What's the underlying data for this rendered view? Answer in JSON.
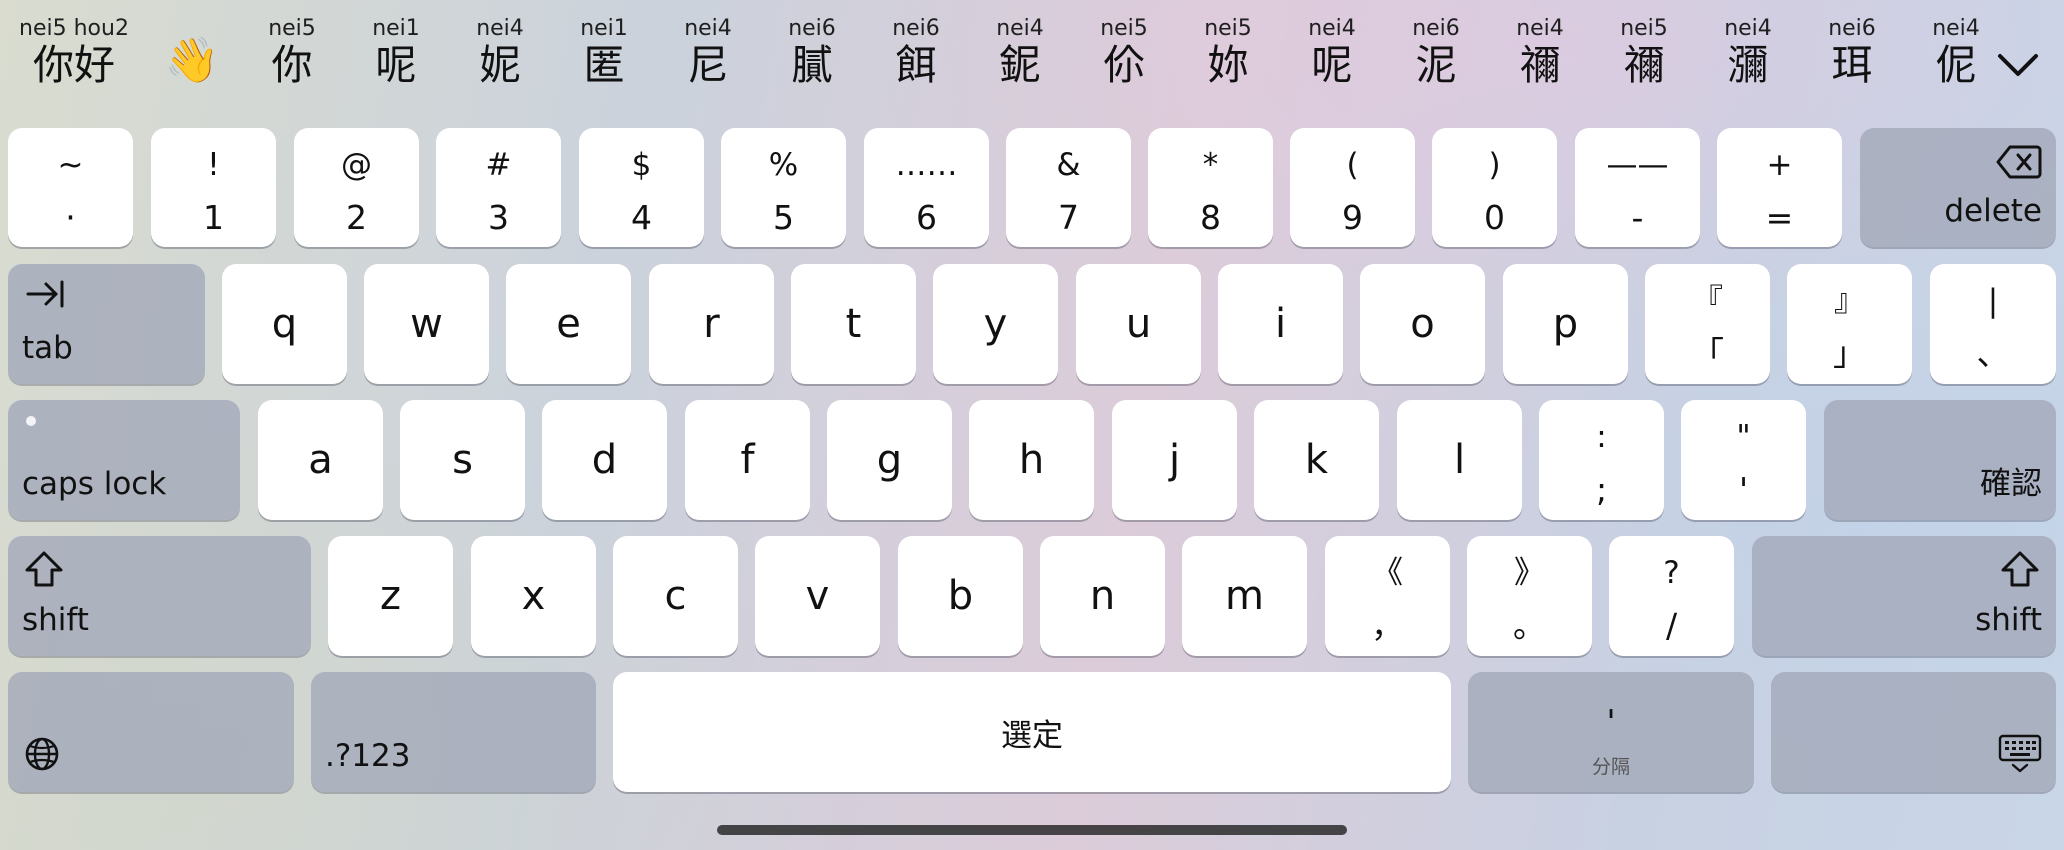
{
  "candidates": [
    {
      "romanization": "nei5 hou2",
      "text": "你好"
    },
    {
      "romanization": "",
      "text": "👋"
    },
    {
      "romanization": "nei5",
      "text": "你"
    },
    {
      "romanization": "nei1",
      "text": "呢"
    },
    {
      "romanization": "nei4",
      "text": "妮"
    },
    {
      "romanization": "nei1",
      "text": "匿"
    },
    {
      "romanization": "nei4",
      "text": "尼"
    },
    {
      "romanization": "nei6",
      "text": "膩"
    },
    {
      "romanization": "nei6",
      "text": "餌"
    },
    {
      "romanization": "nei4",
      "text": "鈮"
    },
    {
      "romanization": "nei5",
      "text": "伱"
    },
    {
      "romanization": "nei5",
      "text": "妳"
    },
    {
      "romanization": "nei4",
      "text": "呢"
    },
    {
      "romanization": "nei6",
      "text": "泥"
    },
    {
      "romanization": "nei4",
      "text": "禰"
    },
    {
      "romanization": "nei5",
      "text": "禰"
    },
    {
      "romanization": "nei4",
      "text": "瀰"
    },
    {
      "romanization": "nei6",
      "text": "珥"
    },
    {
      "romanization": "nei4",
      "text": "伲"
    }
  ],
  "expand_icon": "chevron-down-icon",
  "row1": [
    {
      "name": "tilde",
      "upper": "~",
      "lower": "·"
    },
    {
      "name": "1",
      "upper": "!",
      "lower": "1"
    },
    {
      "name": "2",
      "upper": "@",
      "lower": "2"
    },
    {
      "name": "3",
      "upper": "#",
      "lower": "3"
    },
    {
      "name": "4",
      "upper": "$",
      "lower": "4"
    },
    {
      "name": "5",
      "upper": "%",
      "lower": "5"
    },
    {
      "name": "6",
      "upper": "……",
      "lower": "6"
    },
    {
      "name": "7",
      "upper": "&",
      "lower": "7"
    },
    {
      "name": "8",
      "upper": "*",
      "lower": "8"
    },
    {
      "name": "9",
      "upper": "(",
      "lower": "9"
    },
    {
      "name": "0",
      "upper": ")",
      "lower": "0"
    },
    {
      "name": "dash",
      "upper": "——",
      "lower": "-"
    },
    {
      "name": "equals",
      "upper": "+",
      "lower": "="
    }
  ],
  "delete_label": "delete",
  "tab_label": "tab",
  "row2_letters": [
    "q",
    "w",
    "e",
    "r",
    "t",
    "y",
    "u",
    "i",
    "o",
    "p"
  ],
  "row2_punct": [
    {
      "name": "left-corner-bracket",
      "upper": "『",
      "lower": "「"
    },
    {
      "name": "right-corner-bracket",
      "upper": "』",
      "lower": "」"
    },
    {
      "name": "pipe",
      "upper": "|",
      "lower": "、"
    }
  ],
  "caps_lock_label": "caps lock",
  "row3_letters": [
    "a",
    "s",
    "d",
    "f",
    "g",
    "h",
    "j",
    "k",
    "l"
  ],
  "row3_punct": [
    {
      "name": "semicolon",
      "upper": ":",
      "lower": ";"
    },
    {
      "name": "quote",
      "upper": "\"",
      "lower": "'"
    }
  ],
  "confirm_label": "確認",
  "shift_label": "shift",
  "row4_letters": [
    "z",
    "x",
    "c",
    "v",
    "b",
    "n",
    "m"
  ],
  "row4_punct": [
    {
      "name": "comma",
      "upper": "《",
      "lower": "，"
    },
    {
      "name": "period",
      "upper": "》",
      "lower": "。"
    },
    {
      "name": "slash",
      "upper": "?",
      "lower": "/"
    }
  ],
  "numbers_label": ".?123",
  "space_label": "選定",
  "separator": {
    "symbol": "'",
    "label": "分隔"
  },
  "colors": {
    "key": "#ffffff",
    "function_key": "#a3aaba",
    "text": "#111111"
  }
}
